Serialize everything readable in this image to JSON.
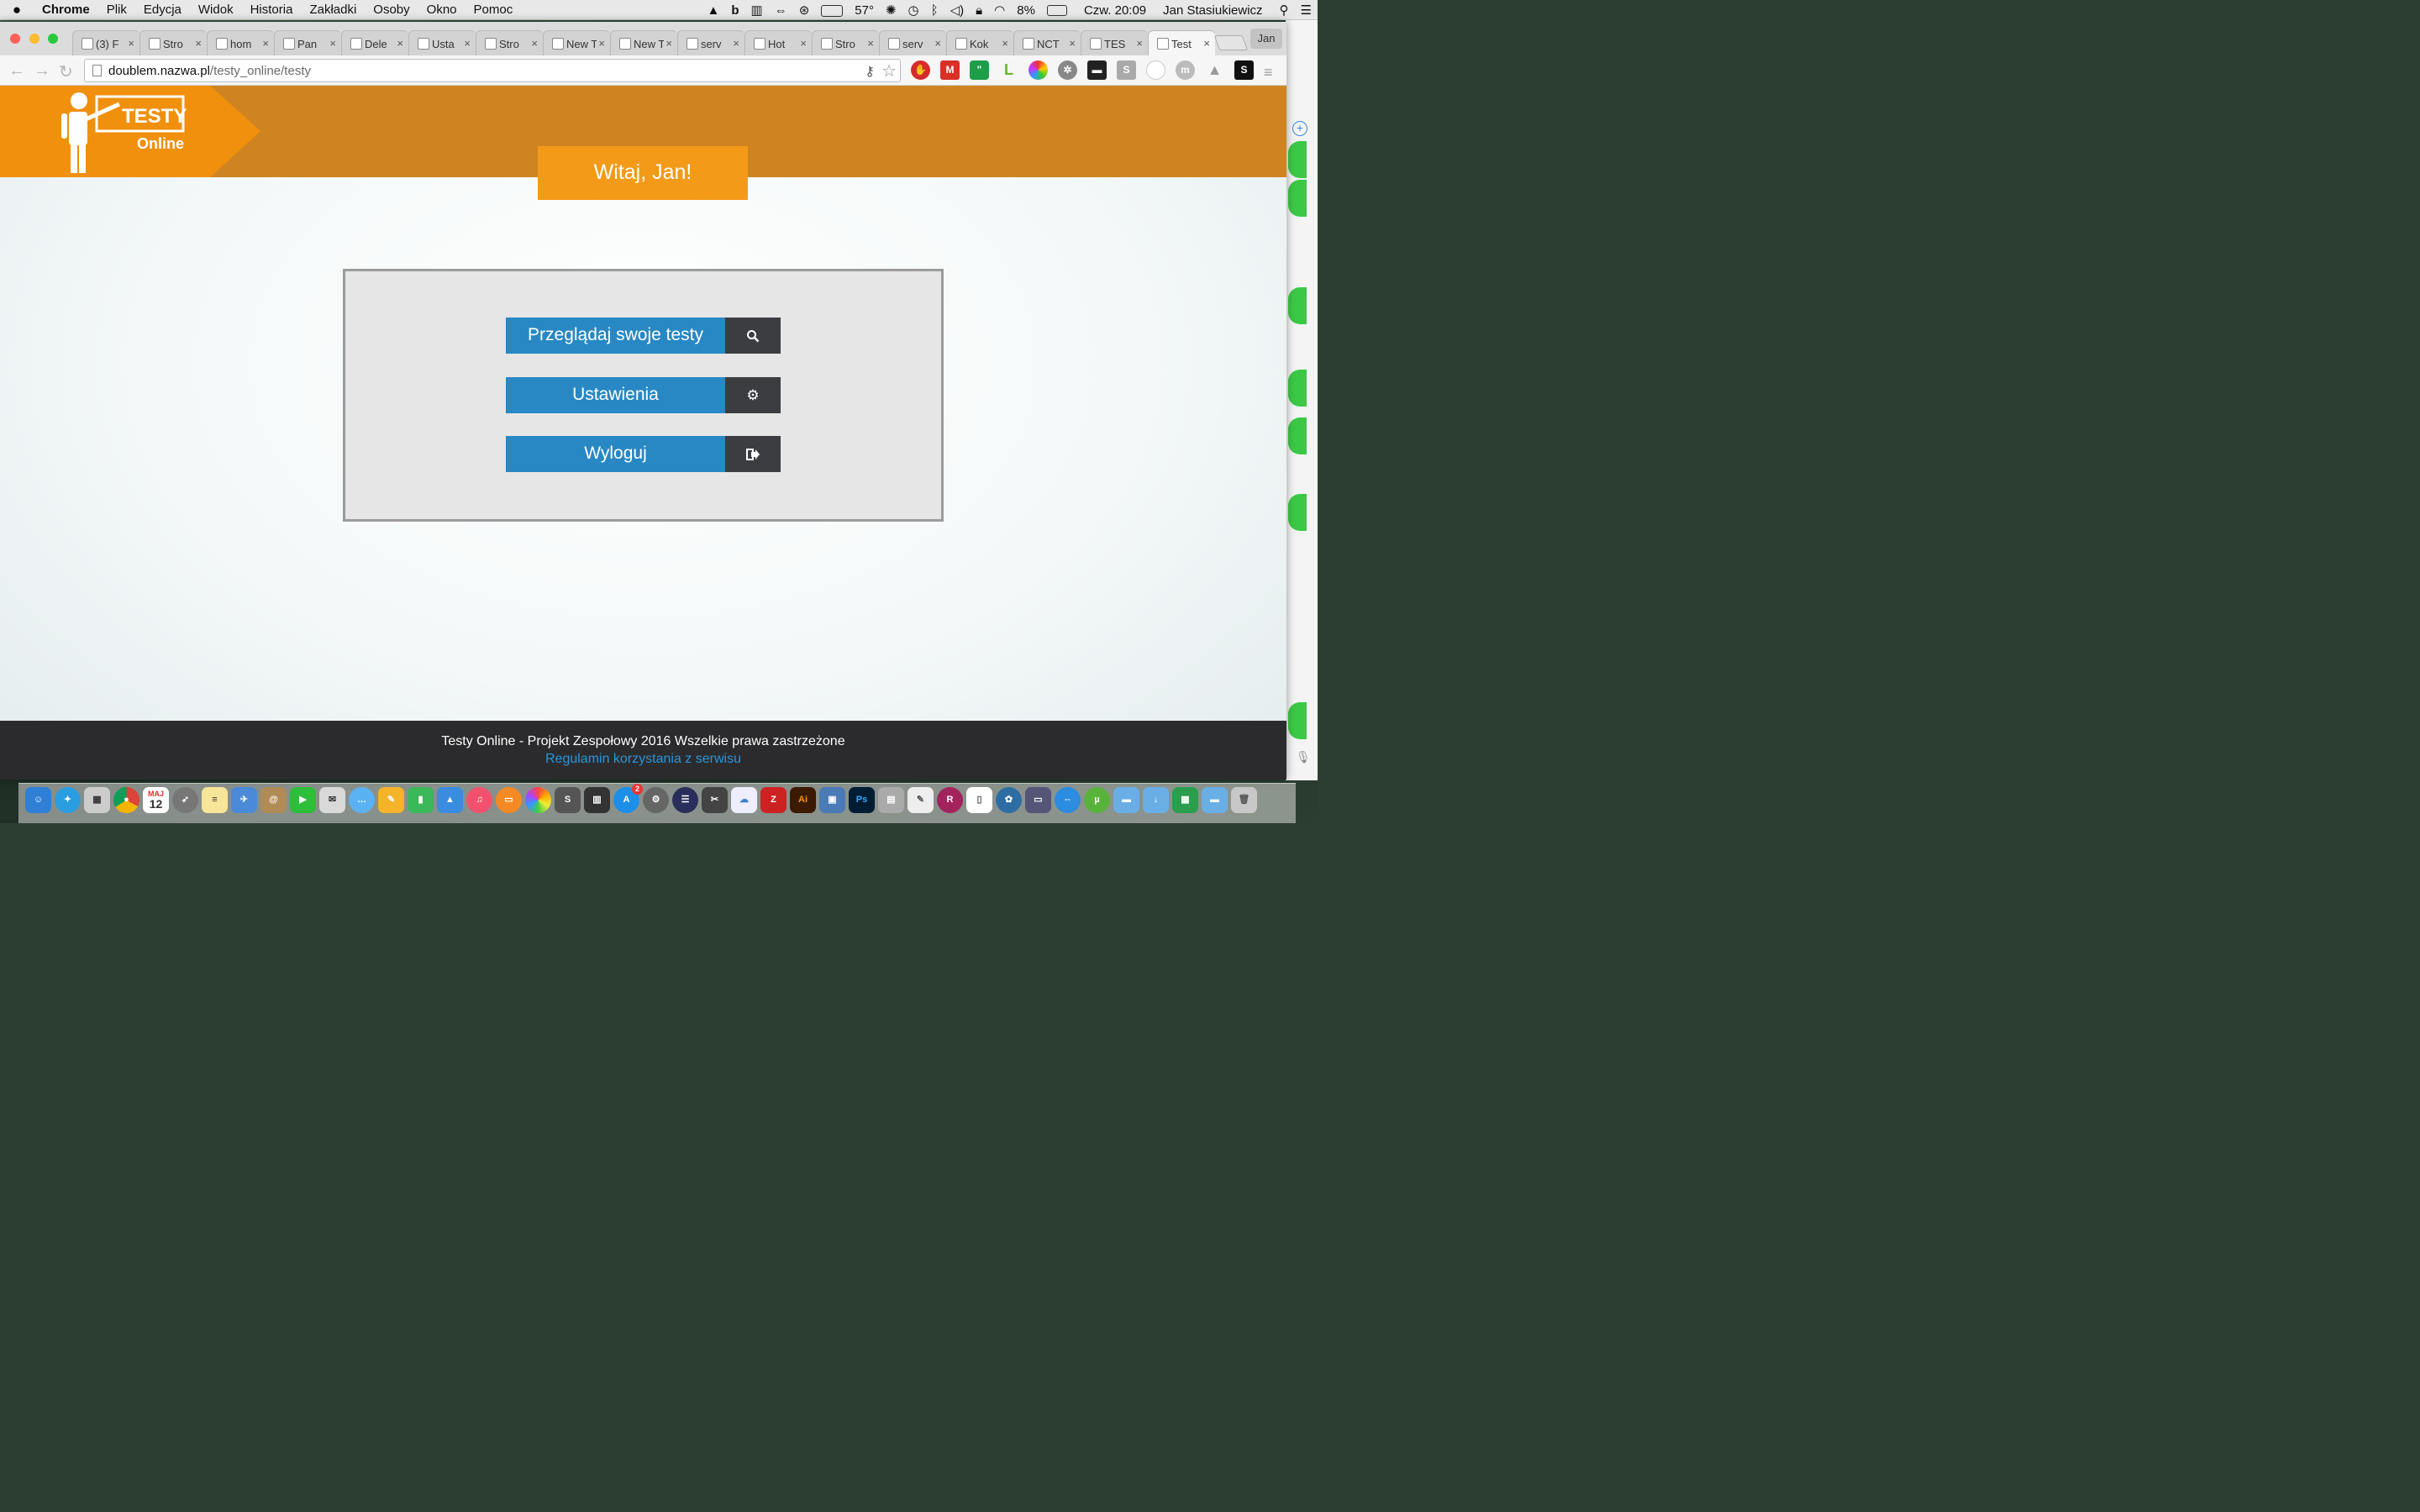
{
  "menubar": {
    "app": "Chrome",
    "items": [
      "Plik",
      "Edycja",
      "Widok",
      "Historia",
      "Zakładki",
      "Osoby",
      "Okno",
      "Pomoc"
    ],
    "status": {
      "temperature": "57°",
      "battery": "8%",
      "clock": "Czw. 20:09",
      "user": "Jan Stasiukiewicz"
    }
  },
  "browser": {
    "tabs": [
      {
        "title": "(3) F",
        "active": false
      },
      {
        "title": "Stro",
        "active": false
      },
      {
        "title": "hom",
        "active": false
      },
      {
        "title": "Pan",
        "active": false
      },
      {
        "title": "Dele",
        "active": false
      },
      {
        "title": "Usta",
        "active": false
      },
      {
        "title": "Stro",
        "active": false
      },
      {
        "title": "New Ta",
        "active": false
      },
      {
        "title": "New Ta",
        "active": false
      },
      {
        "title": "serv",
        "active": false
      },
      {
        "title": "Hot",
        "active": false
      },
      {
        "title": "Stro",
        "active": false
      },
      {
        "title": "serv",
        "active": false
      },
      {
        "title": "Kok",
        "active": false
      },
      {
        "title": "NCT",
        "active": false
      },
      {
        "title": "TES",
        "active": false
      },
      {
        "title": "Test",
        "active": true
      }
    ],
    "profile": "Jan",
    "url": {
      "host": "doublem.nazwa.pl",
      "path": "/testy_online/testy"
    }
  },
  "page": {
    "logo": {
      "line1": "TESTY",
      "line2": "Online"
    },
    "welcome": "Witaj, Jan!",
    "buttons": [
      {
        "label": "Przeglądaj swoje testy",
        "icon": "search-icon"
      },
      {
        "label": "Ustawienia",
        "icon": "gear-icon"
      },
      {
        "label": "Wyloguj",
        "icon": "sign-out-icon"
      }
    ],
    "footer": {
      "text": "Testy Online - Projekt Zespołowy 2016 Wszelkie prawa zastrzeżone",
      "link": "Regulamin korzystania z serwisu"
    }
  },
  "colors": {
    "header": "#cf8421",
    "accent_orange": "#f39a18",
    "button_blue": "#2888c4",
    "button_icon_bg": "#3c3d40",
    "footer_bg": "#2b2b2d",
    "footer_link": "#2c95d8"
  },
  "dock": {
    "calendar_month": "MAJ",
    "calendar_day": "12",
    "app_store_badge": "2"
  }
}
